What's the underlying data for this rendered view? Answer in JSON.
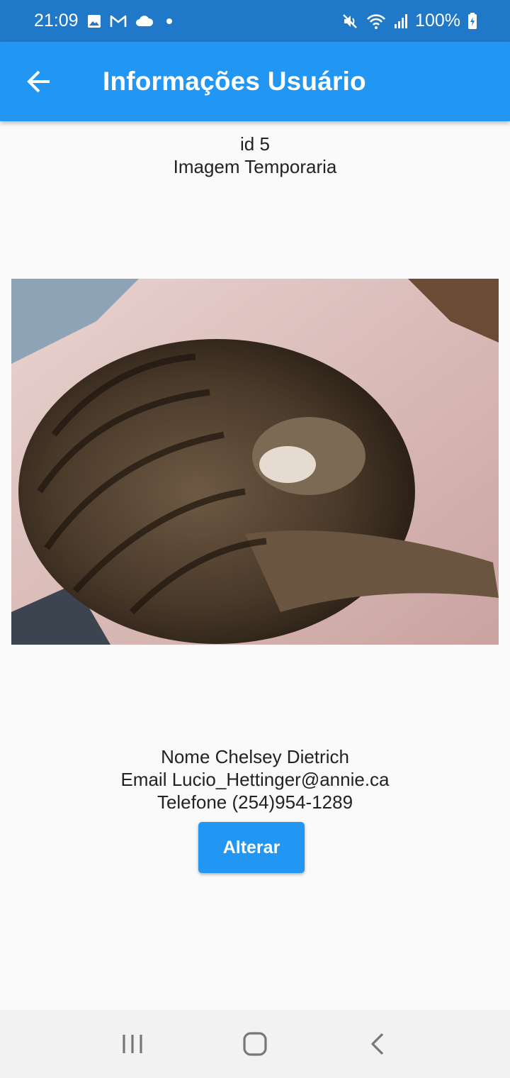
{
  "status_bar": {
    "time": "21:09",
    "battery": "100%",
    "icons_left": [
      "image-icon",
      "gmail-icon",
      "cloud-icon",
      "dot-icon"
    ],
    "icons_right": [
      "mute-icon",
      "wifi-icon",
      "signal-icon",
      "battery-charging-icon"
    ]
  },
  "app_bar": {
    "title": "Informações Usuário",
    "back_icon": "arrow-back-icon"
  },
  "user": {
    "id_line": "id 5",
    "image_caption": "Imagem Temporaria",
    "name_line": "Nome Chelsey Dietrich",
    "email_line": "Email Lucio_Hettinger@annie.ca",
    "phone_line": "Telefone (254)954-1289"
  },
  "actions": {
    "alter_label": "Alterar"
  },
  "nav_bar": {
    "items": [
      "recents-icon",
      "home-icon",
      "back-icon"
    ]
  },
  "colors": {
    "status_bar": "#1f78c8",
    "app_bar": "#2196f3",
    "button": "#2196f3",
    "background": "#fafafa"
  }
}
